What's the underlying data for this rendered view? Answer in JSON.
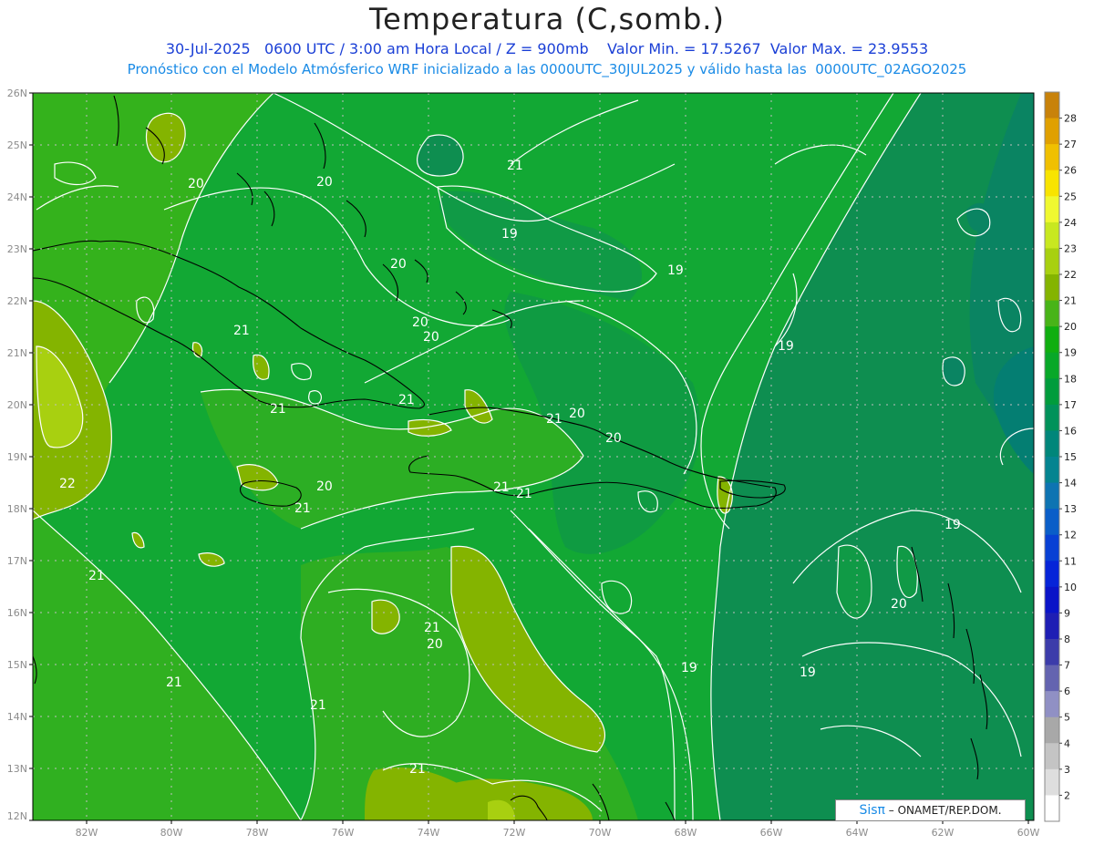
{
  "title": "Temperatura (C,somb.)",
  "subtitle_line1": "30-Jul-2025   0600 UTC / 3:00 am Hora Local / Z = 900mb    Valor Min. = 17.5267  Valor Max. = 23.9553",
  "subtitle_line2": "Pronóstico con el Modelo Atmósferico WRF inicializado a las 0000UTC_30JUL2025 y válido hasta las  0000UTC_02AGO2025",
  "credit": {
    "brand": "Sisπ",
    "text": " – ONAMET/REP.DOM."
  },
  "lat_labels": [
    "26N",
    "25N",
    "24N",
    "23N",
    "22N",
    "21N",
    "20N",
    "19N",
    "18N",
    "17N",
    "16N",
    "15N",
    "14N",
    "13N",
    "12N"
  ],
  "lon_labels": [
    "82W",
    "80W",
    "78W",
    "76W",
    "74W",
    "72W",
    "70W",
    "68W",
    "66W",
    "64W",
    "62W",
    "60W"
  ],
  "colorbar": {
    "labels": [
      "28",
      "27",
      "26",
      "25",
      "24",
      "23",
      "22",
      "21",
      "20",
      "19",
      "18",
      "17",
      "16",
      "15",
      "14",
      "13",
      "12",
      "11",
      "10",
      "9",
      "8",
      "7",
      "6",
      "5",
      "4",
      "3",
      "2"
    ],
    "colors": [
      "#c8820a",
      "#e0a000",
      "#f0c000",
      "#f8e400",
      "#f0f830",
      "#c8e820",
      "#a8d010",
      "#84b400",
      "#48b418",
      "#10ae10",
      "#08a828",
      "#009c3c",
      "#00925a",
      "#00867a",
      "#048490",
      "#0e74b2",
      "#0a5ec8",
      "#0840d4",
      "#0624d8",
      "#0a14c8",
      "#1e1eb4",
      "#3c3caa",
      "#6464b0",
      "#9090c4",
      "#a8a8a8",
      "#c4c4c4",
      "#dedede",
      "#ffffff"
    ]
  },
  "contour_labels": [
    "22",
    "21",
    "21",
    "21",
    "21",
    "21",
    "21",
    "21",
    "21",
    "21",
    "21",
    "21",
    "21",
    "21",
    "20",
    "20",
    "20",
    "20",
    "20",
    "20",
    "20",
    "20",
    "20",
    "20",
    "19",
    "19",
    "19",
    "19",
    "19",
    "19"
  ],
  "colors": {
    "ocean_base": "#12a834",
    "warm": "#34b21c",
    "cool": "#0e8e50",
    "hot": "#84b400",
    "hottest": "#a8d010",
    "grid": "#bfbfbf",
    "contour": "#ffffff",
    "coast": "#000000"
  }
}
